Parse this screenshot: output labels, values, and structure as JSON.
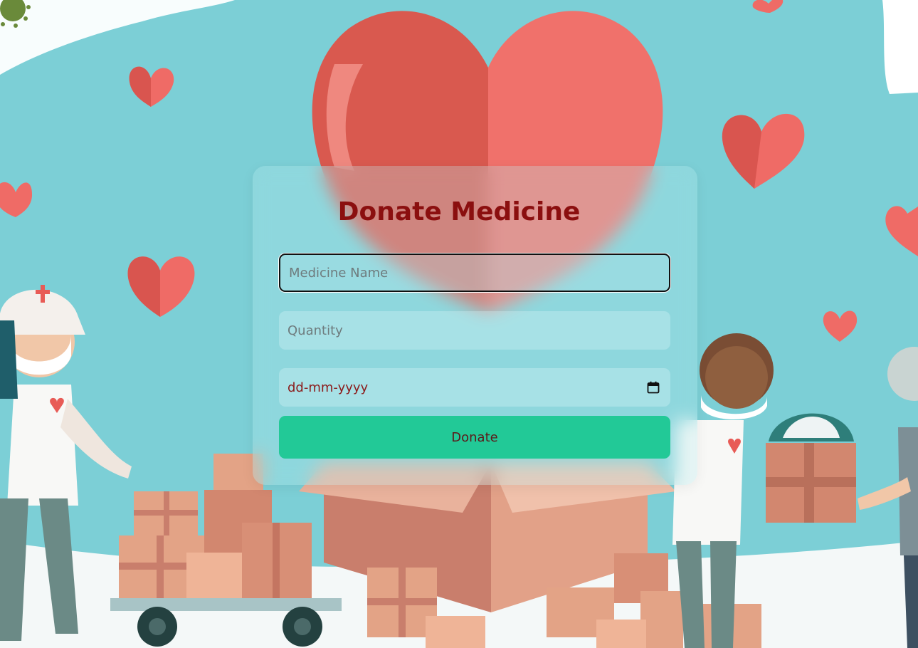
{
  "form": {
    "title": "Donate Medicine",
    "medicine_name": {
      "value": "",
      "placeholder": "Medicine Name"
    },
    "quantity": {
      "value": "",
      "placeholder": "Quantity"
    },
    "date": {
      "display": "dd-mm-yyyy"
    },
    "submit_label": "Donate"
  },
  "colors": {
    "background": "#7ccfd6",
    "title": "#8b0f0f",
    "button": "#22c997",
    "button_text": "#5b1a1a",
    "heart": "#ef6b66"
  },
  "icons": {
    "date_picker": "calendar-icon"
  }
}
